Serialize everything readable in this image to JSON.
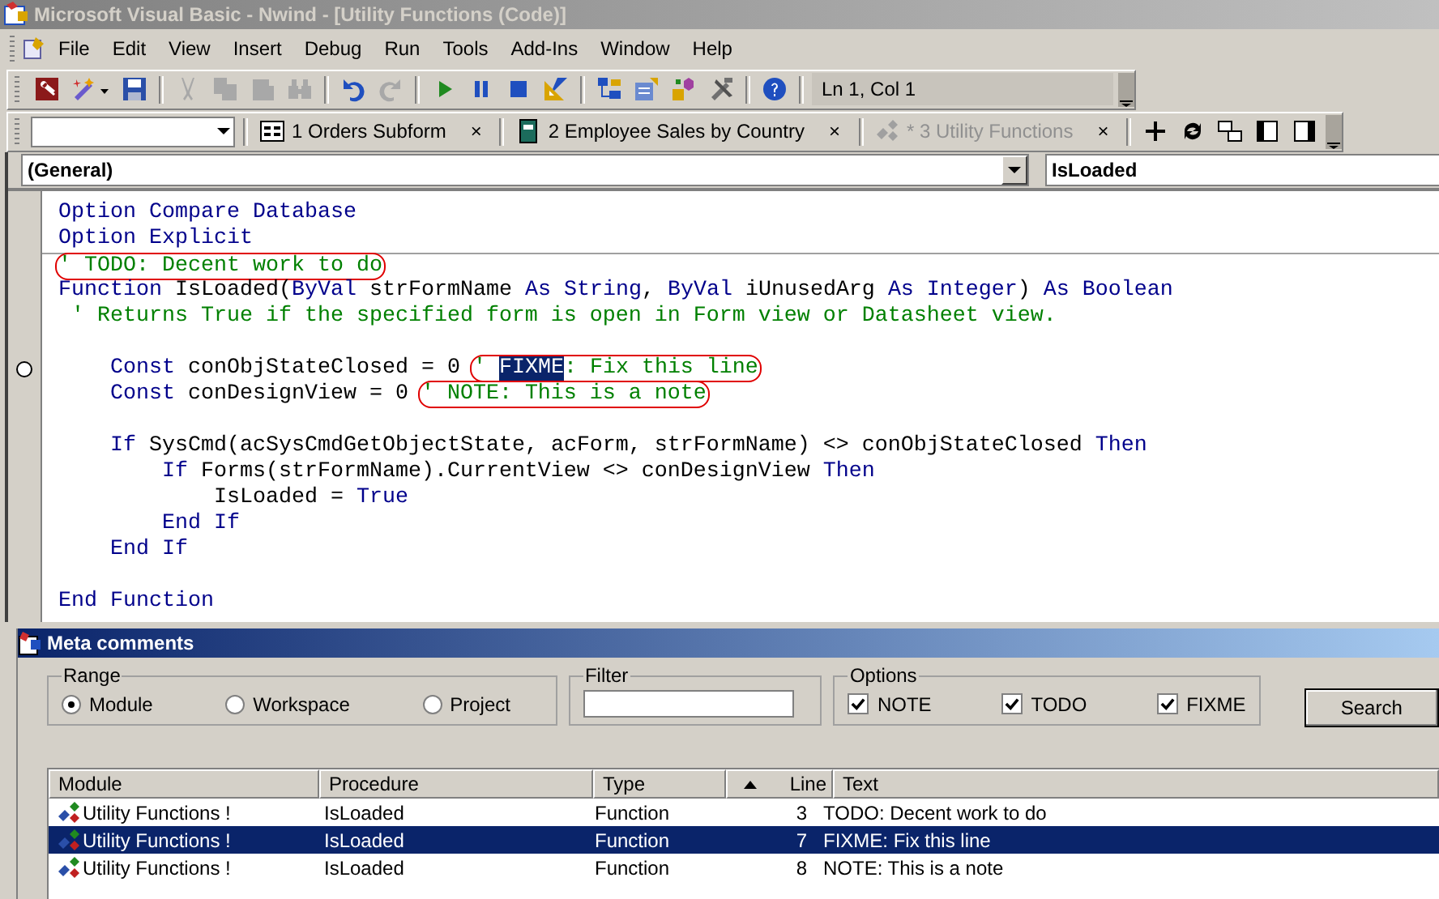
{
  "window": {
    "title": "Microsoft Visual Basic - Nwind - [Utility Functions (Code)]"
  },
  "menu": [
    "File",
    "Edit",
    "View",
    "Insert",
    "Debug",
    "Run",
    "Tools",
    "Add-Ins",
    "Window",
    "Help"
  ],
  "toolbar": {
    "groups": [
      [
        {
          "kind": "access",
          "disabled": false
        },
        {
          "kind": "tools",
          "disabled": false
        },
        {
          "kind": "save",
          "disabled": false
        }
      ],
      [
        {
          "kind": "cut",
          "disabled": true
        },
        {
          "kind": "copy",
          "disabled": true
        },
        {
          "kind": "paste",
          "disabled": true
        },
        {
          "kind": "find",
          "disabled": true
        }
      ],
      [
        {
          "kind": "undo",
          "disabled": false
        },
        {
          "kind": "redo",
          "disabled": true
        }
      ],
      [
        {
          "kind": "run",
          "disabled": false
        },
        {
          "kind": "pause",
          "disabled": false
        },
        {
          "kind": "stop",
          "disabled": false
        },
        {
          "kind": "design",
          "disabled": false
        }
      ],
      [
        {
          "kind": "project",
          "disabled": false
        },
        {
          "kind": "properties",
          "disabled": false
        },
        {
          "kind": "objects",
          "disabled": false
        },
        {
          "kind": "toolbox",
          "disabled": false
        }
      ],
      [
        {
          "kind": "help",
          "disabled": false
        }
      ]
    ],
    "position": "Ln 1, Col 1"
  },
  "tabs": [
    {
      "label": "1 Orders Subform",
      "kind": "form",
      "close": "×",
      "selected": false
    },
    {
      "label": "2 Employee Sales by Country",
      "kind": "report",
      "close": "×",
      "selected": false
    },
    {
      "label": "* 3 Utility Functions",
      "kind": "module",
      "close": "×",
      "selected": true
    }
  ],
  "code_window": {
    "object": "(General)",
    "procedure": "IsLoaded",
    "lines": [
      {
        "tokens": [
          {
            "kind": "keyword",
            "text": "Option Compare Database"
          }
        ],
        "separator_above": false,
        "breakpoint": false
      },
      {
        "tokens": [
          {
            "kind": "keyword",
            "text": "Option Explicit"
          }
        ],
        "separator_above": false,
        "breakpoint": false
      },
      {
        "note": [
          {
            "text": "' TODO: Decent work to do",
            "selected": false
          }
        ],
        "separator_above": true,
        "breakpoint": false
      },
      {
        "tokens": [
          {
            "kind": "keyword",
            "text": "Function"
          },
          {
            "kind": "plain",
            "text": " IsLoaded("
          },
          {
            "kind": "keyword",
            "text": "ByVal"
          },
          {
            "kind": "plain",
            "text": " strFormName "
          },
          {
            "kind": "keyword",
            "text": "As String"
          },
          {
            "kind": "plain",
            "text": ", "
          },
          {
            "kind": "keyword",
            "text": "ByVal"
          },
          {
            "kind": "plain",
            "text": " iUnusedArg "
          },
          {
            "kind": "keyword",
            "text": "As Integer"
          },
          {
            "kind": "plain",
            "text": ") "
          },
          {
            "kind": "keyword",
            "text": "As Boolean"
          }
        ],
        "separator_above": false,
        "breakpoint": false
      },
      {
        "tokens": [
          {
            "kind": "comment",
            "text": " ' Returns True if the specified form is open in Form view or Datasheet view."
          }
        ],
        "separator_above": false,
        "breakpoint": false
      },
      {
        "separator_above": false,
        "breakpoint": false
      },
      {
        "tokens": [
          {
            "kind": "keyword",
            "text": "    Const"
          },
          {
            "kind": "plain",
            "text": " conObjStateClosed = 0 "
          }
        ],
        "note": [
          {
            "text": "' ",
            "selected": false
          },
          {
            "text": "FIXME",
            "selected": true
          },
          {
            "text": ": Fix this line",
            "selected": false
          }
        ],
        "separator_above": false,
        "breakpoint": true
      },
      {
        "tokens": [
          {
            "kind": "keyword",
            "text": "    Const"
          },
          {
            "kind": "plain",
            "text": " conDesignView = 0 "
          }
        ],
        "note": [
          {
            "text": "' NOTE: This is a note",
            "selected": false
          }
        ],
        "separator_above": false,
        "breakpoint": false
      },
      {
        "separator_above": false,
        "breakpoint": false
      },
      {
        "tokens": [
          {
            "kind": "keyword",
            "text": "    If"
          },
          {
            "kind": "plain",
            "text": " SysCmd(acSysCmdGetObjectState, acForm, strFormName) <> conObjStateClosed "
          },
          {
            "kind": "keyword",
            "text": "Then"
          }
        ],
        "separator_above": false,
        "breakpoint": false
      },
      {
        "tokens": [
          {
            "kind": "keyword",
            "text": "        If"
          },
          {
            "kind": "plain",
            "text": " Forms(strFormName).CurrentView <> conDesignView "
          },
          {
            "kind": "keyword",
            "text": "Then"
          }
        ],
        "separator_above": false,
        "breakpoint": false
      },
      {
        "tokens": [
          {
            "kind": "plain",
            "text": "            IsLoaded = "
          },
          {
            "kind": "keyword",
            "text": "True"
          }
        ],
        "separator_above": false,
        "breakpoint": false
      },
      {
        "tokens": [
          {
            "kind": "keyword",
            "text": "        End If"
          }
        ],
        "separator_above": false,
        "breakpoint": false
      },
      {
        "tokens": [
          {
            "kind": "keyword",
            "text": "    End If"
          }
        ],
        "separator_above": false,
        "breakpoint": false
      },
      {
        "separator_above": false,
        "breakpoint": false
      },
      {
        "tokens": [
          {
            "kind": "keyword",
            "text": "End Function"
          }
        ],
        "separator_above": false,
        "breakpoint": false
      }
    ]
  },
  "meta_comments": {
    "title": "Meta comments",
    "range": {
      "label": "Range",
      "options": [
        {
          "label": "Module",
          "selected": true
        },
        {
          "label": "Workspace",
          "selected": false
        },
        {
          "label": "Project",
          "selected": false
        }
      ]
    },
    "filter": {
      "label": "Filter"
    },
    "options": {
      "label": "Options",
      "items": [
        {
          "label": "NOTE",
          "checked": true
        },
        {
          "label": "TODO",
          "checked": true
        },
        {
          "label": "FIXME",
          "checked": true
        }
      ]
    },
    "search_button": "Search",
    "columns": [
      "Module",
      "Procedure",
      "Type",
      "Line",
      "Text"
    ],
    "rows": [
      {
        "module": "Utility Functions !",
        "procedure": "IsLoaded",
        "type": "Function",
        "line": "3",
        "text": "TODO: Decent work to do",
        "selected": false
      },
      {
        "module": "Utility Functions !",
        "procedure": "IsLoaded",
        "type": "Function",
        "line": "7",
        "text": "FIXME: Fix this line",
        "selected": true
      },
      {
        "module": "Utility Functions !",
        "procedure": "IsLoaded",
        "type": "Function",
        "line": "8",
        "text": "NOTE: This is a note",
        "selected": false
      }
    ]
  }
}
